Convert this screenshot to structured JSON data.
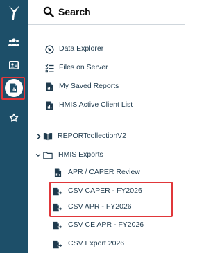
{
  "rail": {
    "items": [
      {
        "icon": "users-icon"
      },
      {
        "icon": "id-card-icon"
      },
      {
        "icon": "report-document-icon",
        "active": true
      },
      {
        "icon": "star-icon"
      }
    ],
    "colors": {
      "background": "#1d4f69",
      "icon": "#ffffff",
      "active_icon": "#1d4f69",
      "highlight": "#e0373a"
    }
  },
  "search": {
    "label": "Search"
  },
  "menu": {
    "links": [
      {
        "label": "Data Explorer",
        "icon": "explorer-icon"
      },
      {
        "label": "Files on Server",
        "icon": "checklist-icon"
      },
      {
        "label": "My Saved Reports",
        "icon": "saved-report-icon"
      },
      {
        "label": "HMIS Active Client List",
        "icon": "report-document-icon"
      }
    ],
    "folders": [
      {
        "label": "REPORTcollectionV2",
        "icon": "book-icon",
        "expanded": false
      },
      {
        "label": "HMIS Exports",
        "icon": "folder-icon",
        "expanded": true
      }
    ],
    "exports": [
      {
        "label": "APR / CAPER Review",
        "icon": "report-document-icon"
      },
      {
        "label": "CSV CAPER - FY2026",
        "icon": "export-file-icon",
        "highlighted": true
      },
      {
        "label": "CSV APR - FY2026",
        "icon": "export-file-icon",
        "highlighted": true
      },
      {
        "label": "CSV CE APR - FY2026",
        "icon": "export-file-icon"
      },
      {
        "label": "CSV Export 2026",
        "icon": "export-file-icon"
      }
    ]
  }
}
